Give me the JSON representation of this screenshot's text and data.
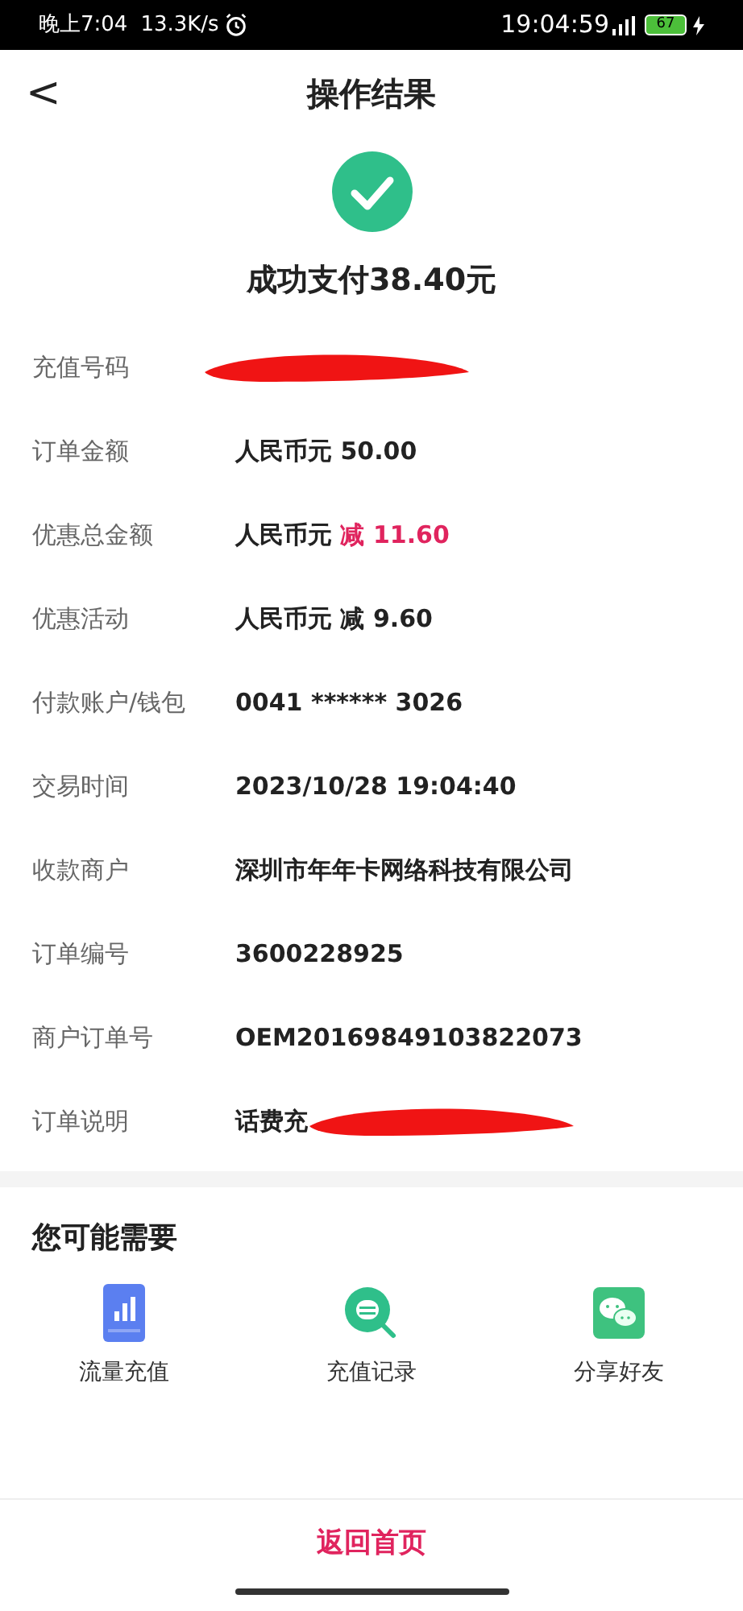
{
  "status_bar": {
    "time": "晚上7:04",
    "speed": "13.3K/s",
    "overlay_clock": "19:04:59",
    "battery": "67"
  },
  "header": {
    "back": "<",
    "title": "操作结果"
  },
  "result": {
    "message": "成功支付38.40元"
  },
  "details": [
    {
      "label": "充值号码",
      "redacted": true
    },
    {
      "label": "订单金额",
      "value": "人民币元 50.00",
      "redacted": false
    },
    {
      "label": "优惠总金额",
      "value": "人民币元",
      "accent": "减 11.60",
      "redacted": false
    },
    {
      "label": "优惠活动",
      "value": "人民币元 减 9.60",
      "redacted": false
    },
    {
      "label": "付款账户/钱包",
      "value": "0041 ****** 3026",
      "redacted": false
    },
    {
      "label": "交易时间",
      "value": "2023/10/28 19:04:40",
      "redacted": false
    },
    {
      "label": "收款商户",
      "value": "深圳市年年卡网络科技有限公司",
      "redacted": false
    },
    {
      "label": "订单编号",
      "value": "3600228925",
      "redacted": false
    },
    {
      "label": "商户订单号",
      "value": "OEM20169849103822073",
      "redacted": false
    },
    {
      "label": "订单说明",
      "value": "话费充",
      "redacted": true
    }
  ],
  "suggestions": {
    "title": "您可能需要",
    "items": [
      {
        "kind": "phone",
        "label": "流量充值"
      },
      {
        "kind": "record",
        "label": "充值记录"
      },
      {
        "kind": "chat",
        "label": "分享好友"
      }
    ]
  },
  "footer": {
    "button": "返回首页"
  }
}
